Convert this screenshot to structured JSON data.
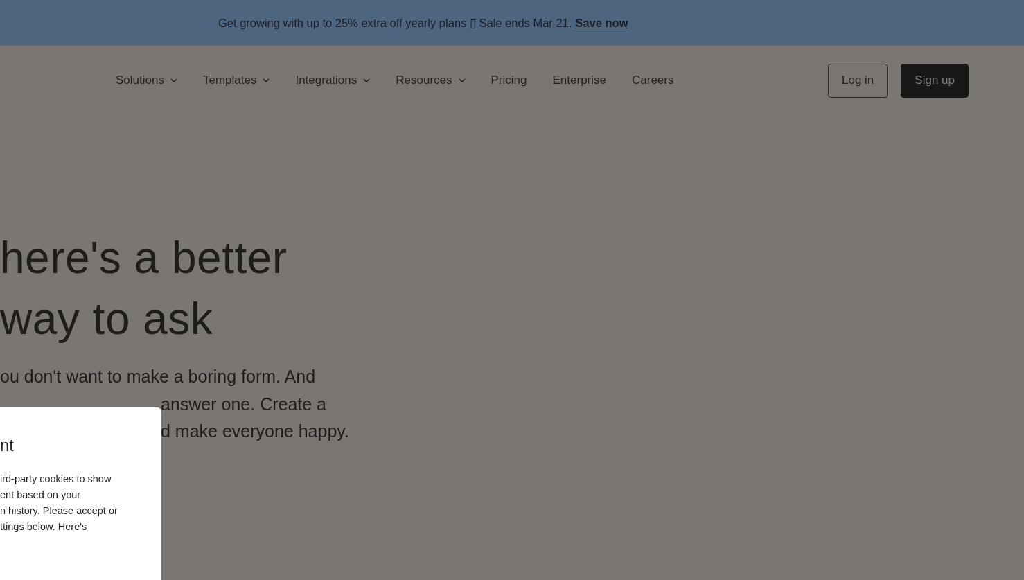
{
  "banner": {
    "text": "Get growing with up to 25% extra off yearly plans ▯ Sale ends Mar 21.",
    "link": "Save now"
  },
  "nav": {
    "items": [
      {
        "label": "Solutions",
        "kind": "dropdown"
      },
      {
        "label": "Templates",
        "kind": "dropdown"
      },
      {
        "label": "Integrations",
        "kind": "dropdown"
      },
      {
        "label": "Resources",
        "kind": "dropdown"
      },
      {
        "label": "Pricing",
        "kind": "link"
      },
      {
        "label": "Enterprise",
        "kind": "link"
      },
      {
        "label": "Careers",
        "kind": "link"
      }
    ],
    "buttons": [
      {
        "label": "Log in",
        "kind": "outline"
      },
      {
        "label": "Sign up",
        "kind": "filled"
      }
    ]
  },
  "hero": {
    "heading": [
      "here's a better",
      "way to ask"
    ],
    "paragraph": [
      "ou don't want to make a boring form. And",
      "answer one. Create a",
      "d make everyone happy."
    ]
  },
  "cookie_dialog": {
    "title": "nt",
    "body": "ird-party cookies to show\nent based on your\nn history. Please accept or\nttings below. Here's"
  }
}
